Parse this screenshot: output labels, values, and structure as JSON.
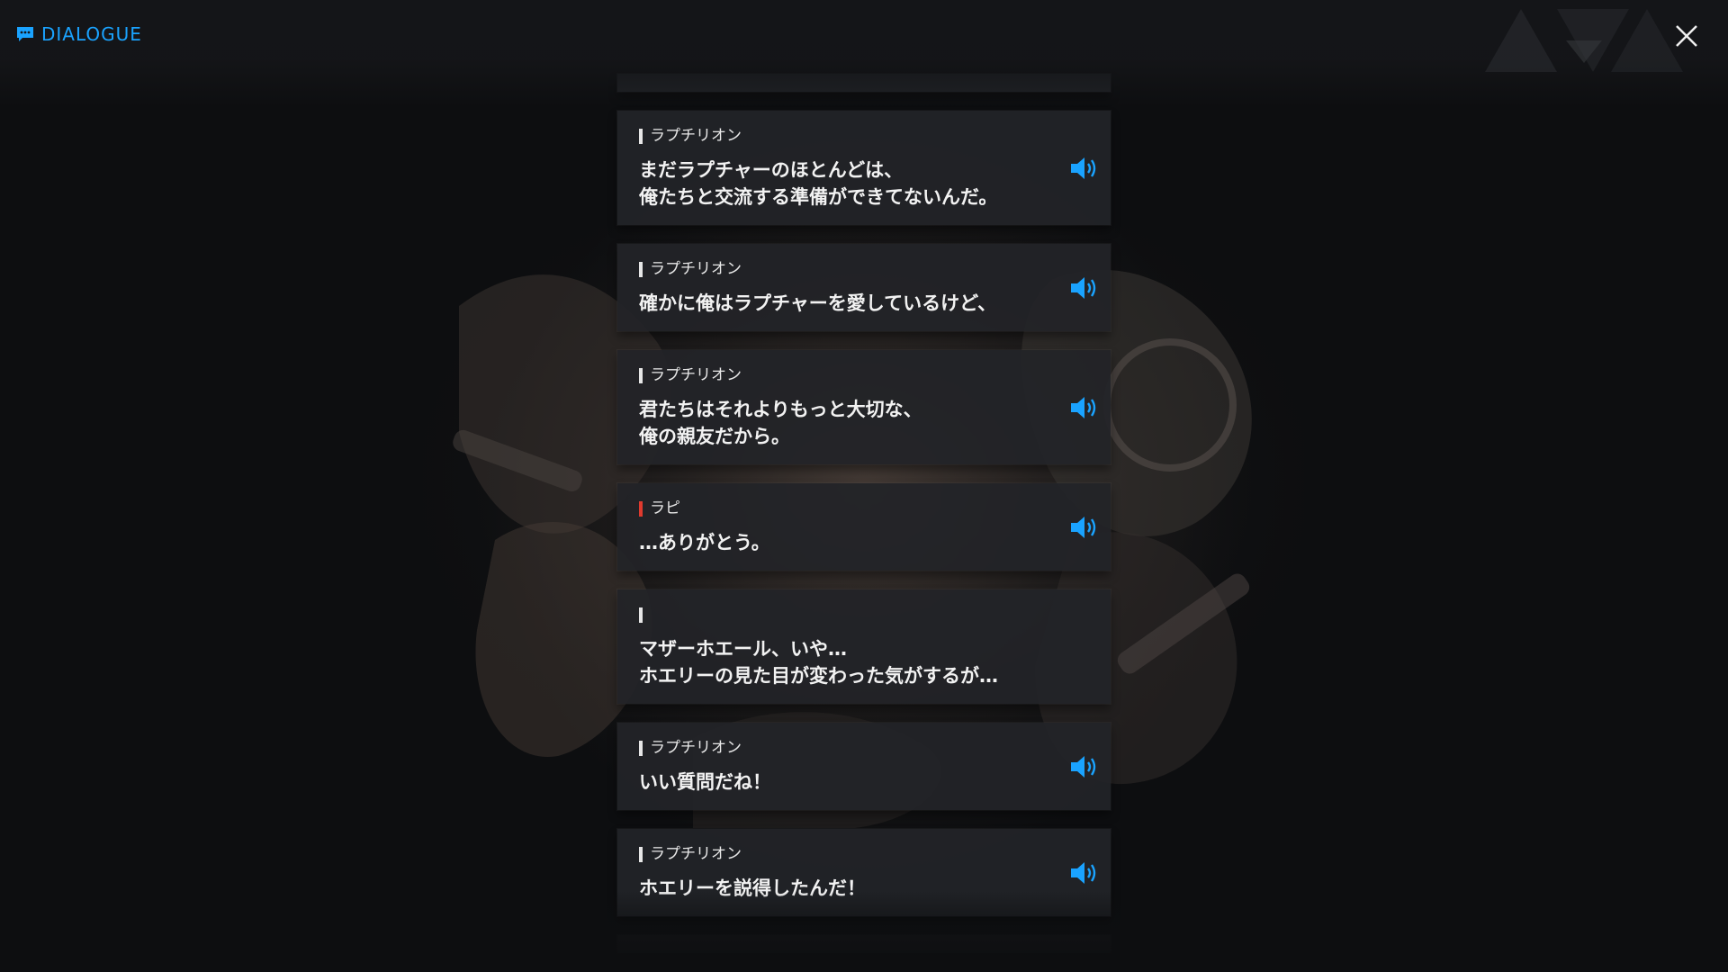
{
  "header": {
    "title": "DIALOGUE",
    "title_icon": "chat-bubble-icon",
    "close_icon": "close-icon",
    "accent": "#1aa3ff"
  },
  "dialogue": [
    {
      "speaker": "ラプチリオン",
      "text": "まだラプチャーのほとんどは、\n俺たちと交流する準備ができてないんだ。",
      "bar_color": "white",
      "voice": true
    },
    {
      "speaker": "ラプチリオン",
      "text": "確かに俺はラプチャーを愛しているけど、",
      "bar_color": "white",
      "voice": true
    },
    {
      "speaker": "ラプチリオン",
      "text": "君たちはそれよりもっと大切な、\n俺の親友だから。",
      "bar_color": "white",
      "voice": true
    },
    {
      "speaker": "ラピ",
      "text": "…ありがとう。",
      "bar_color": "red",
      "voice": true
    },
    {
      "speaker": "",
      "text": "マザーホエール、いや…\nホエリーの見た目が変わった気がするが…",
      "bar_color": "white",
      "voice": false
    },
    {
      "speaker": "ラプチリオン",
      "text": "いい質問だね！",
      "bar_color": "white",
      "voice": true
    },
    {
      "speaker": "ラプチリオン",
      "text": "ホエリーを説得したんだ！",
      "bar_color": "white",
      "voice": true
    }
  ],
  "colors": {
    "speaker_bar": "#e6e6e6",
    "speaker_bar_highlight": "#e03a2e",
    "voice_icon": "#1aa3ff",
    "card_bg": "#222428"
  }
}
